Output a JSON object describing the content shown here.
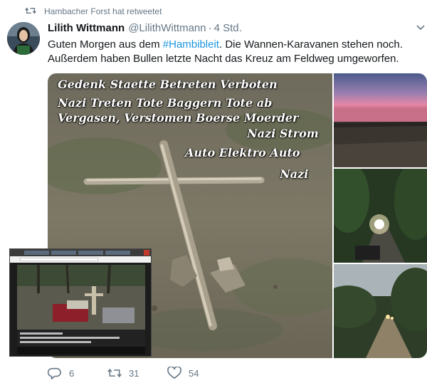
{
  "context": {
    "retweeted_by": "Hambacher Forst hat retweetet"
  },
  "tweet": {
    "author_name": "Lilith Wittmann",
    "author_handle": "@LilithWittmann",
    "separator": "·",
    "timestamp": "4 Std.",
    "text_before_hashtag": "Guten Morgen aus dem ",
    "hashtag": "#Hambibleit",
    "text_after_hashtag": ". Die Wannen-Karavanen stehen noch. Außerdem haben Bullen letzte Nacht das Kreuz am Feldweg umgeworfen."
  },
  "media": {
    "photo_overlay_lines": [
      "Gedenk Staette Betreten Verboten",
      "Nazi Treten Tote Baggern Tote ab",
      "Vergasen, Verstomen Boerse Moerder",
      "Nazi Strom",
      "Auto Elektro Auto",
      "Nazi"
    ]
  },
  "actions": {
    "replies": "6",
    "retweets": "31",
    "likes": "54"
  },
  "icons": {
    "retweet_context": "retweet-icon",
    "menu": "chevron-down-icon",
    "reply": "reply-icon",
    "retweet": "retweet-icon",
    "like": "heart-icon"
  },
  "colors": {
    "text": "#14171a",
    "secondary": "#657786",
    "link": "#1b95e0"
  }
}
